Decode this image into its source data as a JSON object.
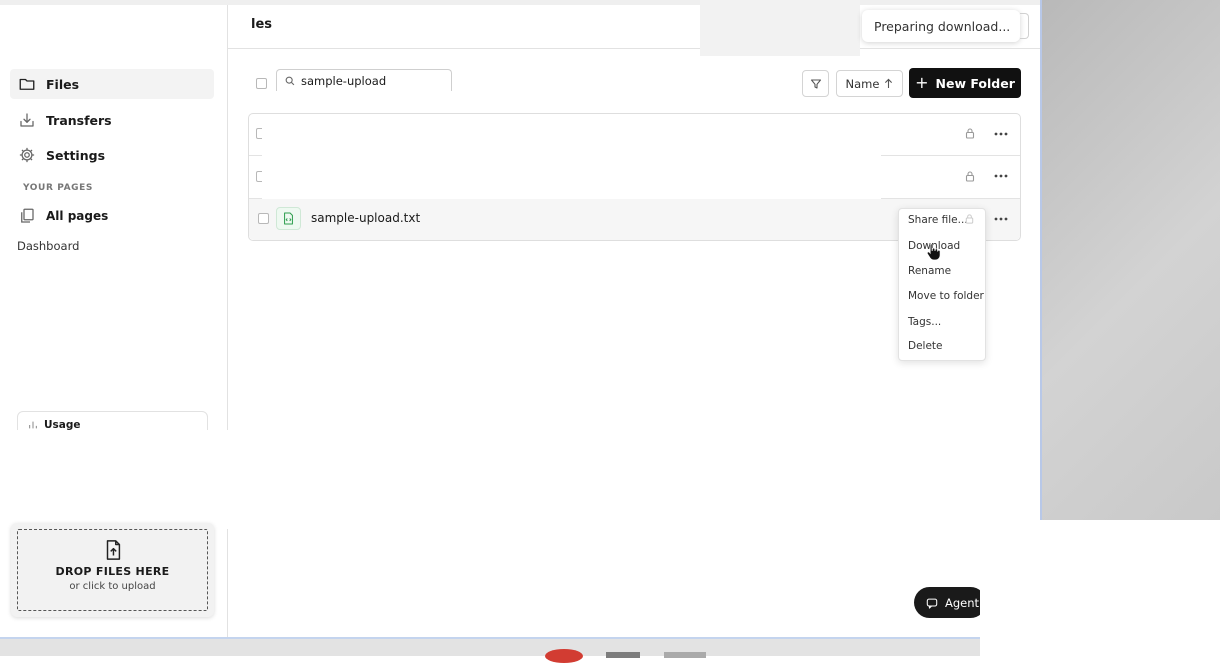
{
  "sidebar": {
    "nav": [
      {
        "label": "Files",
        "icon": "folder-icon"
      },
      {
        "label": "Transfers",
        "icon": "transfers-icon"
      },
      {
        "label": "Settings",
        "icon": "gear-icon"
      }
    ],
    "section_label": "YOUR PAGES",
    "all_pages": "All pages",
    "dashboard": "Dashboard",
    "usage_title": "Usage",
    "drop_title": "DROP FILES HERE",
    "drop_subtitle": "or click to upload"
  },
  "header": {
    "title": "les",
    "toast": "Preparing download..."
  },
  "toolbar": {
    "search_value": "sample-upload",
    "sort_label": "Name",
    "new_folder_label": "New Folder"
  },
  "files": [
    {
      "name": ""
    },
    {
      "name": ""
    },
    {
      "name": "sample-upload.txt",
      "icon": "code-file-icon"
    }
  ],
  "context_menu": {
    "items": [
      "Share file...",
      "Download",
      "Rename",
      "Move to folder",
      "Tags...",
      "Delete"
    ]
  },
  "agent_label": "Agent",
  "colors": {
    "accent": "#111111",
    "file_icon": "#2e9e4e"
  }
}
